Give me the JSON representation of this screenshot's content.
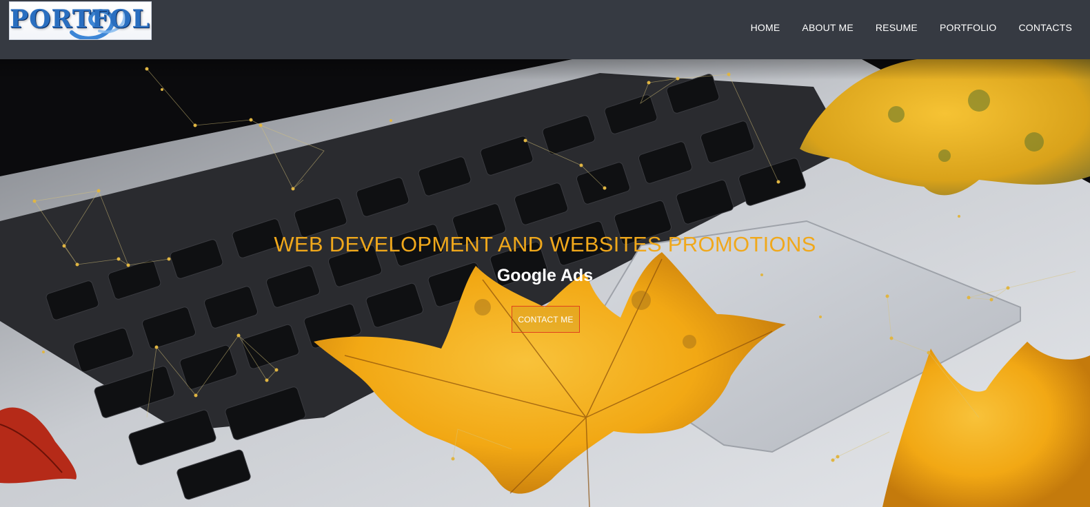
{
  "header": {
    "logo_text": "PORTFOLIO",
    "nav": [
      {
        "label": "HOME"
      },
      {
        "label": "ABOUT ME"
      },
      {
        "label": "RESUME"
      },
      {
        "label": "PORTFOLIO"
      },
      {
        "label": "CONTACTS"
      }
    ]
  },
  "hero": {
    "title": "WEB DEVELOPMENT AND WEBSITES PROMOTIONS",
    "subtitle": "Google Ads",
    "cta_label": "CONTACT ME"
  },
  "colors": {
    "header_bg": "#363a42",
    "title": "#f0a81b",
    "cta_border": "#e0401d",
    "leaf": "#f5b31a"
  }
}
